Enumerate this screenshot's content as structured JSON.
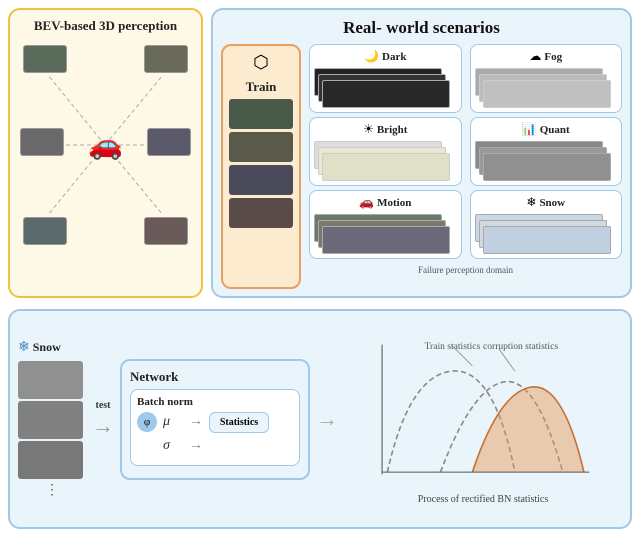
{
  "title": "Real- world scenarios",
  "bev": {
    "title": "BEV-based 3D perception"
  },
  "scenarios": {
    "train": {
      "label": "Train",
      "icon": "⬡"
    },
    "items": [
      {
        "label": "Dark",
        "icon": "🌙",
        "row": 0
      },
      {
        "label": "Fog",
        "icon": "☁",
        "row": 0
      },
      {
        "label": "Bright",
        "icon": "☀",
        "row": 1
      },
      {
        "label": "Quant",
        "icon": "📊",
        "row": 1
      },
      {
        "label": "Motion",
        "icon": "🚗",
        "row": 2
      },
      {
        "label": "Snow",
        "icon": "❄",
        "row": 2
      }
    ],
    "failure_label": "Failure perception domain"
  },
  "bottom": {
    "snow_label": "Snow",
    "test_label": "test",
    "network_title": "Network",
    "batch_norm_title": "Batch norm",
    "param_mu": "μ",
    "param_sigma": "σ",
    "statistics_label": "Statistics",
    "train_stats_label": "Train statistics",
    "corruption_stats_label": "corruption statistics",
    "process_label": "Process of rectified BN statistics"
  }
}
